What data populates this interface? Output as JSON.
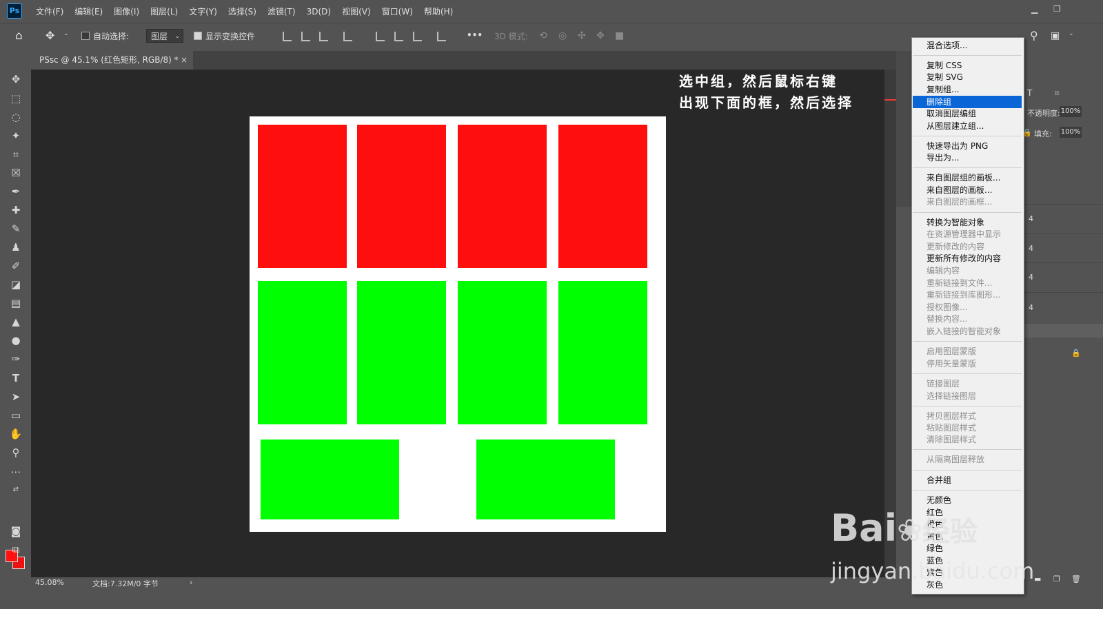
{
  "app": {
    "logo": "Ps"
  },
  "menubar": {
    "items": [
      "文件(F)",
      "编辑(E)",
      "图像(I)",
      "图层(L)",
      "文字(Y)",
      "选择(S)",
      "滤镜(T)",
      "3D(D)",
      "视图(V)",
      "窗口(W)",
      "帮助(H)"
    ]
  },
  "options": {
    "auto_select_label": "自动选择:",
    "auto_select_checked": false,
    "auto_select_value": "图层",
    "show_transform_label": "显示变换控件",
    "show_transform_checked": true,
    "more": "•••",
    "mode_3d_label": "3D 模式:"
  },
  "document_tab": {
    "title": "PSsc @ 45.1% (红色矩形, RGB/8) *",
    "close": "×"
  },
  "canvas": {
    "background": "#282828",
    "document_fill": "#ffffff",
    "rect_colors": {
      "red": "#ff0e0e",
      "green": "#00ff00"
    },
    "rows": [
      {
        "color": "red",
        "count": 4
      },
      {
        "color": "green",
        "count": 4
      },
      {
        "color": "green",
        "count": 2
      }
    ]
  },
  "annotation": {
    "line1": "选中组，然后鼠标右键",
    "line2": "出现下面的框，然后选择",
    "color": "#ffffff"
  },
  "status": {
    "zoom": "45.08%",
    "doc_info": "文档:7.32M/0 字节",
    "arrow": "›"
  },
  "right_panel": {
    "opacity_label": "不透明度:",
    "opacity_value": "100%",
    "fill_label": "填充:",
    "fill_value": "100%",
    "layer_badges": [
      "4",
      "4",
      "4",
      "4"
    ]
  },
  "context_menu": {
    "highlight_color": "#0a66d6",
    "items": [
      {
        "label": "混合选项...",
        "disabled": false
      },
      {
        "label": "复制 CSS",
        "disabled": false
      },
      {
        "label": "复制 SVG",
        "disabled": false
      },
      {
        "label": "复制组...",
        "disabled": false
      },
      {
        "label": "删除组",
        "disabled": false,
        "highlighted": true
      },
      {
        "label": "取消图层编组",
        "disabled": false
      },
      {
        "label": "从图层建立组...",
        "disabled": false
      },
      {
        "label": "快速导出为 PNG",
        "disabled": false
      },
      {
        "label": "导出为...",
        "disabled": false
      },
      {
        "label": "来自图层组的画板...",
        "disabled": false
      },
      {
        "label": "来自图层的画板...",
        "disabled": false
      },
      {
        "label": "来自图层的画框...",
        "disabled": true
      },
      {
        "label": "转换为智能对象",
        "disabled": false
      },
      {
        "label": "在资源管理器中显示",
        "disabled": true
      },
      {
        "label": "更新修改的内容",
        "disabled": true
      },
      {
        "label": "更新所有修改的内容",
        "disabled": false
      },
      {
        "label": "编辑内容",
        "disabled": true
      },
      {
        "label": "重新链接到文件...",
        "disabled": true
      },
      {
        "label": "重新链接到库图形...",
        "disabled": true
      },
      {
        "label": "授权图像...",
        "disabled": true
      },
      {
        "label": "替换内容...",
        "disabled": true
      },
      {
        "label": "嵌入链接的智能对象",
        "disabled": true
      },
      {
        "label": "启用图层蒙版",
        "disabled": true
      },
      {
        "label": "停用矢量蒙版",
        "disabled": true
      },
      {
        "label": "链接图层",
        "disabled": true
      },
      {
        "label": "选择链接图层",
        "disabled": true
      },
      {
        "label": "拷贝图层样式",
        "disabled": true
      },
      {
        "label": "粘贴图层样式",
        "disabled": true
      },
      {
        "label": "清除图层样式",
        "disabled": true
      },
      {
        "label": "从隔离图层释放",
        "disabled": true
      },
      {
        "label": "合并组",
        "disabled": false
      },
      {
        "label": "无颜色",
        "disabled": false
      },
      {
        "label": "红色",
        "disabled": false
      },
      {
        "label": "橙色",
        "disabled": false
      },
      {
        "label": "黄色",
        "disabled": false
      },
      {
        "label": "绿色",
        "disabled": false
      },
      {
        "label": "蓝色",
        "disabled": false
      },
      {
        "label": "紫色",
        "disabled": false
      },
      {
        "label": "灰色",
        "disabled": false
      }
    ]
  },
  "watermark": {
    "brand": "Bai",
    "brand2": "经验",
    "site": "jingyan.baidu.com"
  }
}
